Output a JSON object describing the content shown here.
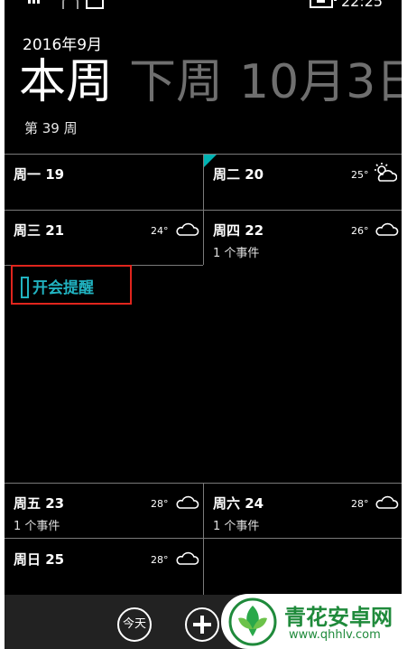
{
  "status_bar": {
    "time": "22:25"
  },
  "header": {
    "month": "2016年9月",
    "pivots": [
      "本周",
      "下周",
      "10月3日"
    ],
    "week_number": "第 39 周"
  },
  "days": [
    {
      "label": "周一 19",
      "temp": "",
      "event": ""
    },
    {
      "label": "周二 20",
      "temp": "25°",
      "weather_icon": "partly-sunny-icon",
      "event": ""
    },
    {
      "label": "周三 21",
      "temp": "24°",
      "weather_icon": "cloud-icon",
      "event": ""
    },
    {
      "label": "周四 22",
      "temp": "26°",
      "weather_icon": "cloud-icon",
      "event": "1 个事件"
    },
    {
      "label": "周五 23",
      "temp": "28°",
      "weather_icon": "cloud-icon",
      "event": "1 个事件"
    },
    {
      "label": "周六 24",
      "temp": "28°",
      "weather_icon": "cloud-icon",
      "event": "1 个事件"
    },
    {
      "label": "周日 25",
      "temp": "28°",
      "weather_icon": "cloud-icon",
      "event": ""
    }
  ],
  "selected_event": {
    "title": "开会提醒",
    "highlight_color": "#e0251d",
    "accent_color": "#21b3c1"
  },
  "appbar": {
    "today_label": "今天",
    "add_icon": "add-icon"
  },
  "watermark": {
    "name": "青花安卓网",
    "url": "www.qhhlv.com"
  }
}
